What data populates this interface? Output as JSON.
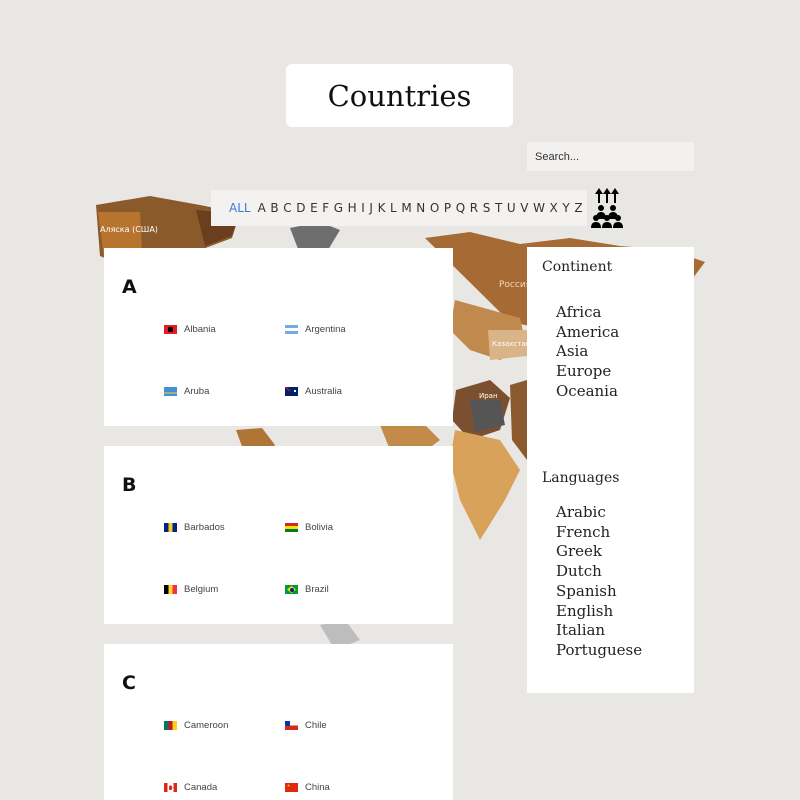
{
  "header": {
    "title": "Countries"
  },
  "search": {
    "placeholder": "Search..."
  },
  "letters": [
    "ALL",
    "A",
    "B",
    "C",
    "D",
    "E",
    "F",
    "G",
    "H",
    "I",
    "J",
    "K",
    "L",
    "M",
    "N",
    "O",
    "P",
    "Q",
    "R",
    "S",
    "T",
    "U",
    "V",
    "W",
    "X",
    "Y",
    "Z"
  ],
  "background_labels": {
    "usa": "Аляска (США)",
    "russia": "Россия",
    "kazakhstan": "Казахстан",
    "iran": "Иран"
  },
  "sections": [
    {
      "letter": "A",
      "countries": [
        {
          "name": "Albania",
          "flag": "albania-flag"
        },
        {
          "name": "Argentina",
          "flag": "argentina-flag"
        },
        {
          "name": "Aruba",
          "flag": "aruba-flag"
        },
        {
          "name": "Australia",
          "flag": "australia-flag"
        }
      ]
    },
    {
      "letter": "B",
      "countries": [
        {
          "name": "Barbados",
          "flag": "barbados-flag"
        },
        {
          "name": "Bolivia",
          "flag": "bolivia-flag"
        },
        {
          "name": "Belgium",
          "flag": "belgium-flag"
        },
        {
          "name": "Brazil",
          "flag": "brazil-flag"
        }
      ]
    },
    {
      "letter": "C",
      "countries": [
        {
          "name": "Cameroon",
          "flag": "cameroon-flag"
        },
        {
          "name": "Chile",
          "flag": "chile-flag"
        },
        {
          "name": "Canada",
          "flag": "canada-flag"
        },
        {
          "name": "China",
          "flag": "china-flag"
        }
      ]
    }
  ],
  "filters": {
    "continent": {
      "heading": "Continent",
      "items": [
        "Africa",
        "America",
        "Asia",
        "Europe",
        "Oceania"
      ]
    },
    "languages": {
      "heading": "Languages",
      "items": [
        "Arabic",
        "French",
        "Greek",
        "Dutch",
        "Spanish",
        "English",
        "Italian",
        "Portuguese"
      ]
    }
  },
  "colors": {
    "accent": "#3a7bd5",
    "background": "#e9e7e4"
  }
}
